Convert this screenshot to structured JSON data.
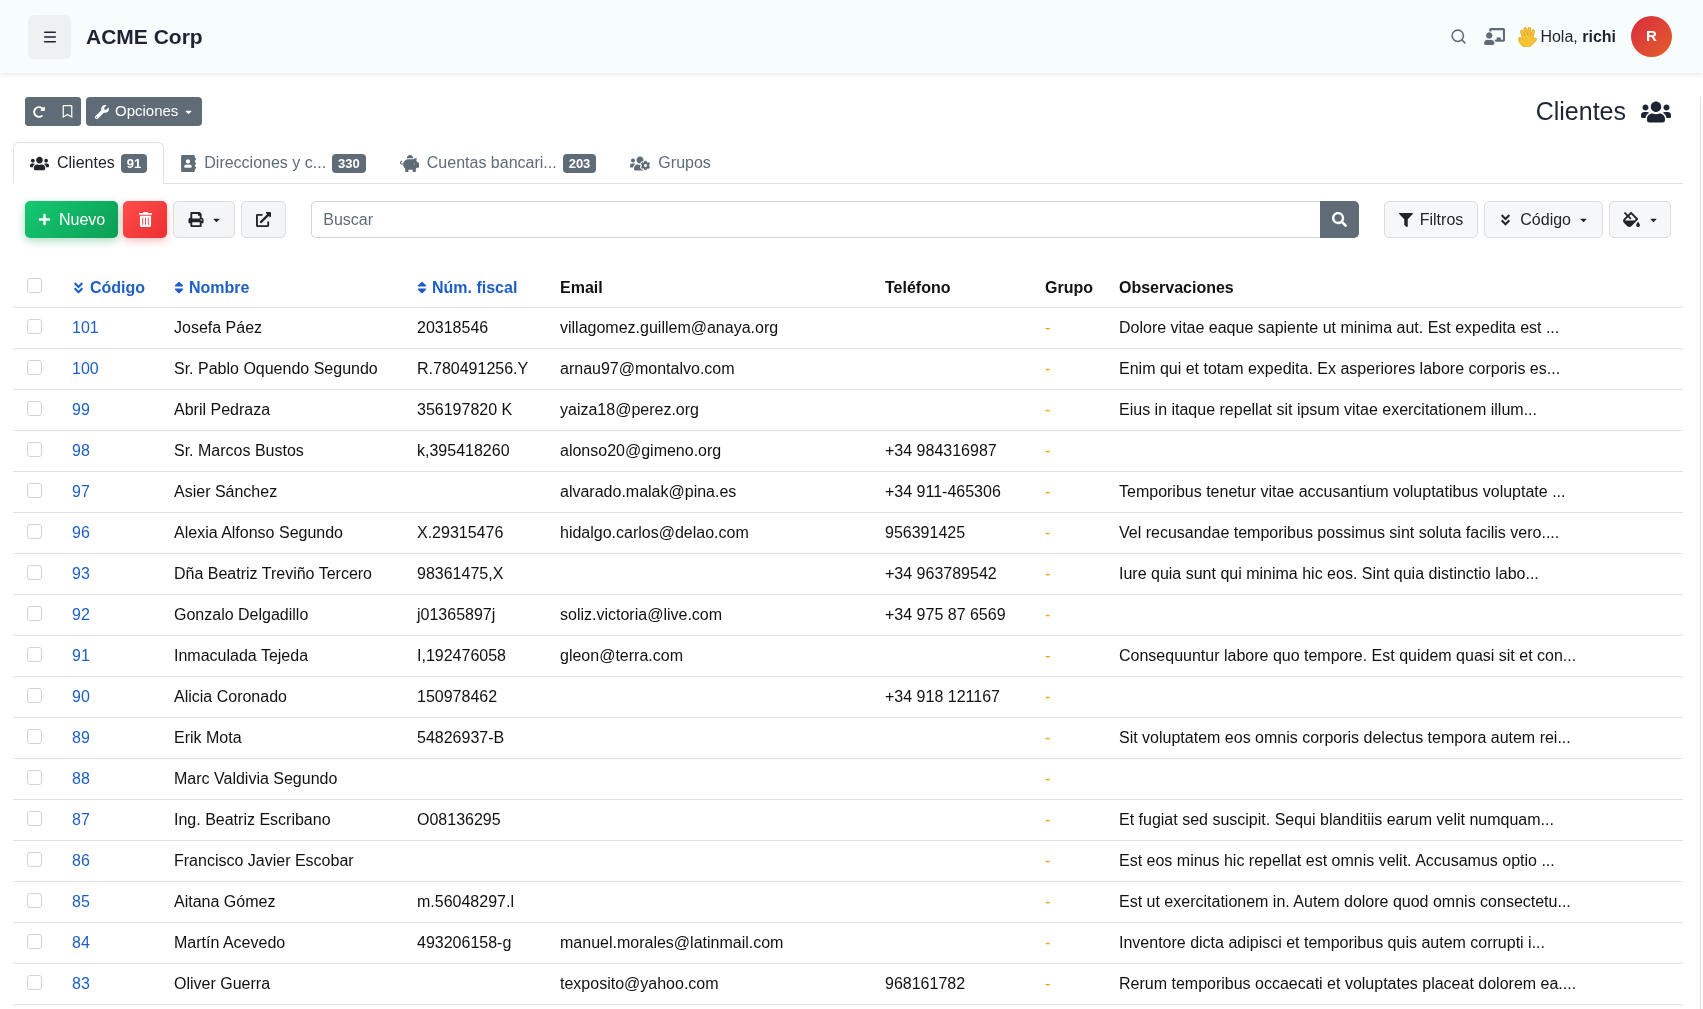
{
  "header": {
    "title": "ACME Corp",
    "greeting": "Hola, **richi**",
    "avatar": {
      "initial": "R"
    }
  },
  "toolbar": {
    "options_label": "Opciones",
    "page_title": "Clientes"
  },
  "tabs": [
    {
      "label": "Clientes",
      "count": "91",
      "selected": true
    },
    {
      "label": "Direcciones y c...",
      "count": "330",
      "selected": false
    },
    {
      "label": "Cuentas bancari...",
      "count": "203",
      "selected": false
    },
    {
      "label": "Grupos",
      "selected": false
    }
  ],
  "actions": {
    "new_label": "Nuevo",
    "search": {
      "placeholder": "Buscar"
    },
    "filters_label": "Filtros",
    "order_label": "Código"
  },
  "table": {
    "select_all": {
      "checked": false
    },
    "columns": [
      {
        "label": "Código",
        "sortable": true,
        "sorted_descending": true
      },
      {
        "label": "Nombre",
        "sortable": true,
        "sorted_descending": false
      },
      {
        "label": "Núm. fiscal",
        "sortable": true,
        "sorted_descending": false
      },
      {
        "label": "Email",
        "sortable": false,
        "sorted_descending": false
      },
      {
        "label": "Teléfono",
        "sortable": false,
        "sorted_descending": false
      },
      {
        "label": "Grupo",
        "sortable": false,
        "sorted_descending": false
      },
      {
        "label": "Observaciones",
        "sortable": false,
        "sorted_descending": false
      }
    ],
    "rows": [
      {
        "checked": false,
        "code": "101",
        "name": "Josefa Páez",
        "fiscal": "20318546",
        "email": "villagomez.guillem@anaya.org",
        "group": "-",
        "notes": "Dolore vitae eaque sapiente ut minima aut. Est expedita est ..."
      },
      {
        "checked": false,
        "code": "100",
        "name": "Sr. Pablo Oquendo Segundo",
        "fiscal": "R.780491256.Y",
        "email": "arnau97@montalvo.com",
        "group": "-",
        "notes": "Enim qui et totam expedita. Ex asperiores labore corporis es..."
      },
      {
        "checked": false,
        "code": "99",
        "name": "Abril Pedraza",
        "fiscal": "356197820 K",
        "email": "yaiza18@perez.org",
        "group": "-",
        "notes": "Eius in itaque repellat sit ipsum vitae exercitationem illum..."
      },
      {
        "checked": false,
        "code": "98",
        "name": "Sr. Marcos Bustos",
        "fiscal": "k,395418260",
        "email": "alonso20@gimeno.org",
        "phone": "+34 984316987",
        "group": "-"
      },
      {
        "checked": false,
        "code": "97",
        "name": "Asier Sánchez",
        "email": "alvarado.malak@pina.es",
        "phone": "+34 911-465306",
        "group": "-",
        "notes": "Temporibus tenetur vitae accusantium voluptatibus voluptate ..."
      },
      {
        "checked": false,
        "code": "96",
        "name": "Alexia Alfonso Segundo",
        "fiscal": "X.29315476",
        "email": "hidalgo.carlos@delao.com",
        "phone": "956391425",
        "group": "-",
        "notes": "Vel recusandae temporibus possimus sint soluta facilis vero...."
      },
      {
        "checked": false,
        "code": "93",
        "name": "Dña Beatriz Treviño Tercero",
        "fiscal": "98361475,X",
        "phone": "+34 963789542",
        "group": "-",
        "notes": "Iure quia sunt qui minima hic eos. Sint quia distinctio labo..."
      },
      {
        "checked": false,
        "code": "92",
        "name": "Gonzalo Delgadillo",
        "fiscal": "j01365897j",
        "email": "soliz.victoria@live.com",
        "phone": "+34 975 87 6569",
        "group": "-"
      },
      {
        "checked": false,
        "code": "91",
        "name": "Inmaculada Tejeda",
        "fiscal": "I,192476058",
        "email": "gleon@terra.com",
        "group": "-",
        "notes": "Consequuntur labore quo tempore. Est quidem quasi sit et con..."
      },
      {
        "checked": false,
        "code": "90",
        "name": "Alicia Coronado",
        "fiscal": "150978462",
        "phone": "+34 918 121167",
        "group": "-"
      },
      {
        "checked": false,
        "code": "89",
        "name": "Erik Mota",
        "fiscal": "54826937-B",
        "group": "-",
        "notes": "Sit voluptatem eos omnis corporis delectus tempora autem rei..."
      },
      {
        "checked": false,
        "code": "88",
        "name": "Marc Valdivia Segundo",
        "group": "-"
      },
      {
        "checked": false,
        "code": "87",
        "name": "Ing. Beatriz Escribano",
        "fiscal": "O08136295",
        "group": "-",
        "notes": "Et fugiat sed suscipit. Sequi blanditiis earum velit numquam..."
      },
      {
        "checked": false,
        "code": "86",
        "name": "Francisco Javier Escobar",
        "group": "-",
        "notes": "Est eos minus hic repellat est omnis velit. Accusamus optio ..."
      },
      {
        "checked": false,
        "code": "85",
        "name": "Aitana Gómez",
        "fiscal": "m.56048297.l",
        "group": "-",
        "notes": "Est ut exercitationem in. Autem dolore quod omnis consectetu..."
      },
      {
        "checked": false,
        "code": "84",
        "name": "Martín Acevedo",
        "fiscal": "493206158-g",
        "email": "manuel.morales@latinmail.com",
        "group": "-",
        "notes": "Inventore dicta adipisci et temporibus quis autem corrupti i..."
      },
      {
        "checked": false,
        "code": "83",
        "name": "Oliver Guerra",
        "email": "texposito@yahoo.com",
        "phone": "968161782",
        "group": "-",
        "notes": "Rerum temporibus occaecati et voluptates placeat dolorem ea...."
      }
    ]
  }
}
